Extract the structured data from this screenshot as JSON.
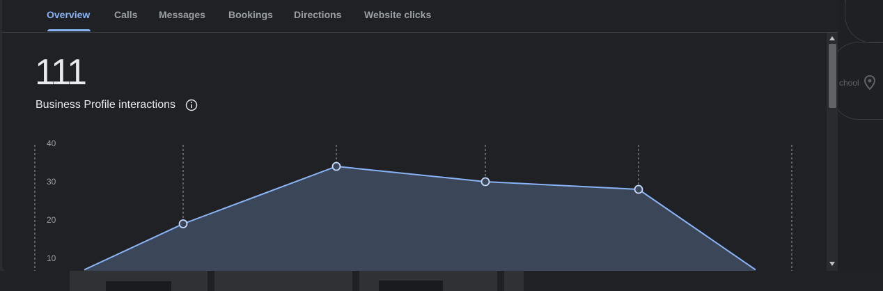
{
  "tabs": [
    {
      "label": "Overview",
      "active": true
    },
    {
      "label": "Calls",
      "active": false
    },
    {
      "label": "Messages",
      "active": false
    },
    {
      "label": "Bookings",
      "active": false
    },
    {
      "label": "Directions",
      "active": false
    },
    {
      "label": "Website clicks",
      "active": false
    }
  ],
  "summary": {
    "total": "111",
    "label": "Business Profile interactions",
    "info_icon": "info-icon"
  },
  "map_label": "chool",
  "colors": {
    "accent": "#8ab4f8",
    "panel_bg": "#202124",
    "area_fill": "#3c4659",
    "text_primary": "#e8eaed",
    "text_secondary": "#9aa0a6"
  },
  "chart_data": {
    "type": "area",
    "ylim": [
      0,
      40
    ],
    "yticks": [
      "40",
      "30",
      "20",
      "10"
    ],
    "x": [
      0,
      1,
      2,
      3,
      4,
      5
    ],
    "values": [
      7,
      19,
      34,
      30,
      28,
      7
    ],
    "marked_points": [
      1,
      2,
      3,
      4
    ],
    "grid": "vertical dashed"
  }
}
